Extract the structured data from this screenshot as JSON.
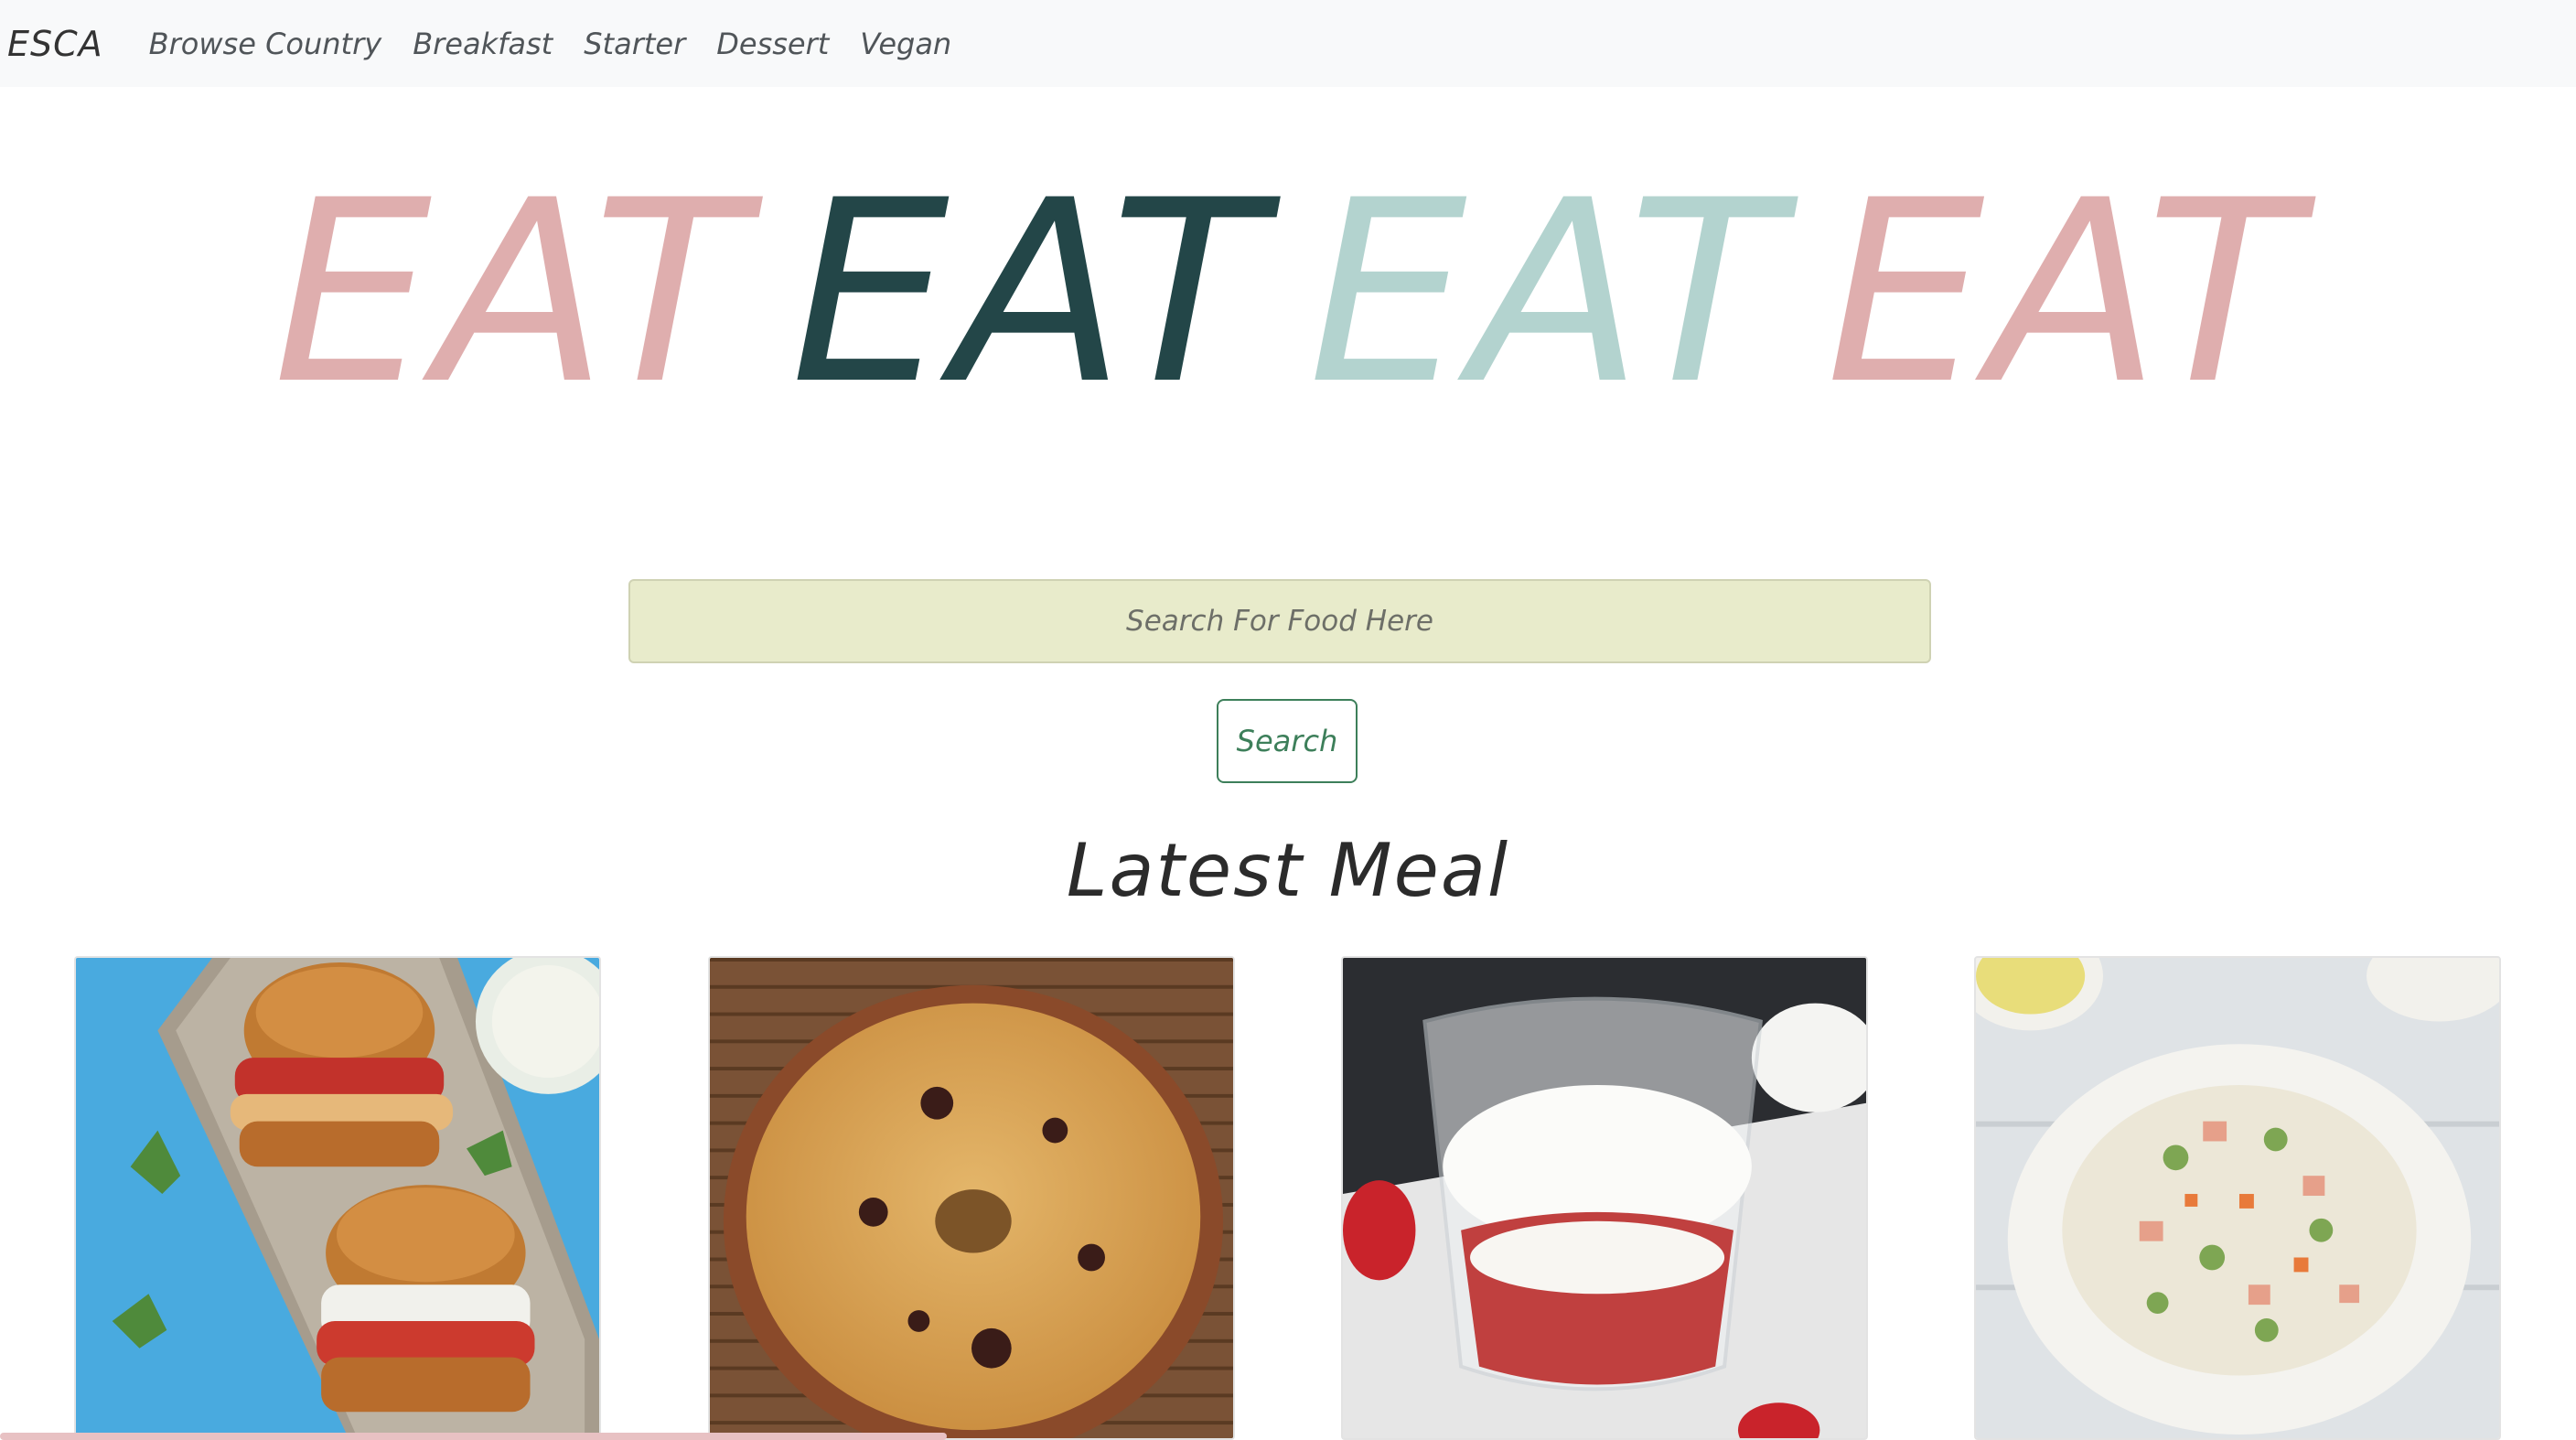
{
  "navbar": {
    "brand": "ESCA",
    "links": [
      "Browse Country",
      "Breakfast",
      "Starter",
      "Dessert",
      "Vegan"
    ]
  },
  "hero": {
    "words": [
      {
        "text": "EAT",
        "color": "#dfaeae"
      },
      {
        "text": "EAT",
        "color": "#234648"
      },
      {
        "text": "EAT",
        "color": "#b3d3cf"
      },
      {
        "text": "EAT",
        "color": "#dfaeae"
      }
    ]
  },
  "search": {
    "placeholder": "Search For Food Here",
    "value": "",
    "button_label": "Search"
  },
  "section": {
    "title": "Latest Meal"
  },
  "colors": {
    "accent_green": "#3d7f5a",
    "search_bg": "#e8ebcb",
    "navbar_bg": "#f8f9fa"
  }
}
